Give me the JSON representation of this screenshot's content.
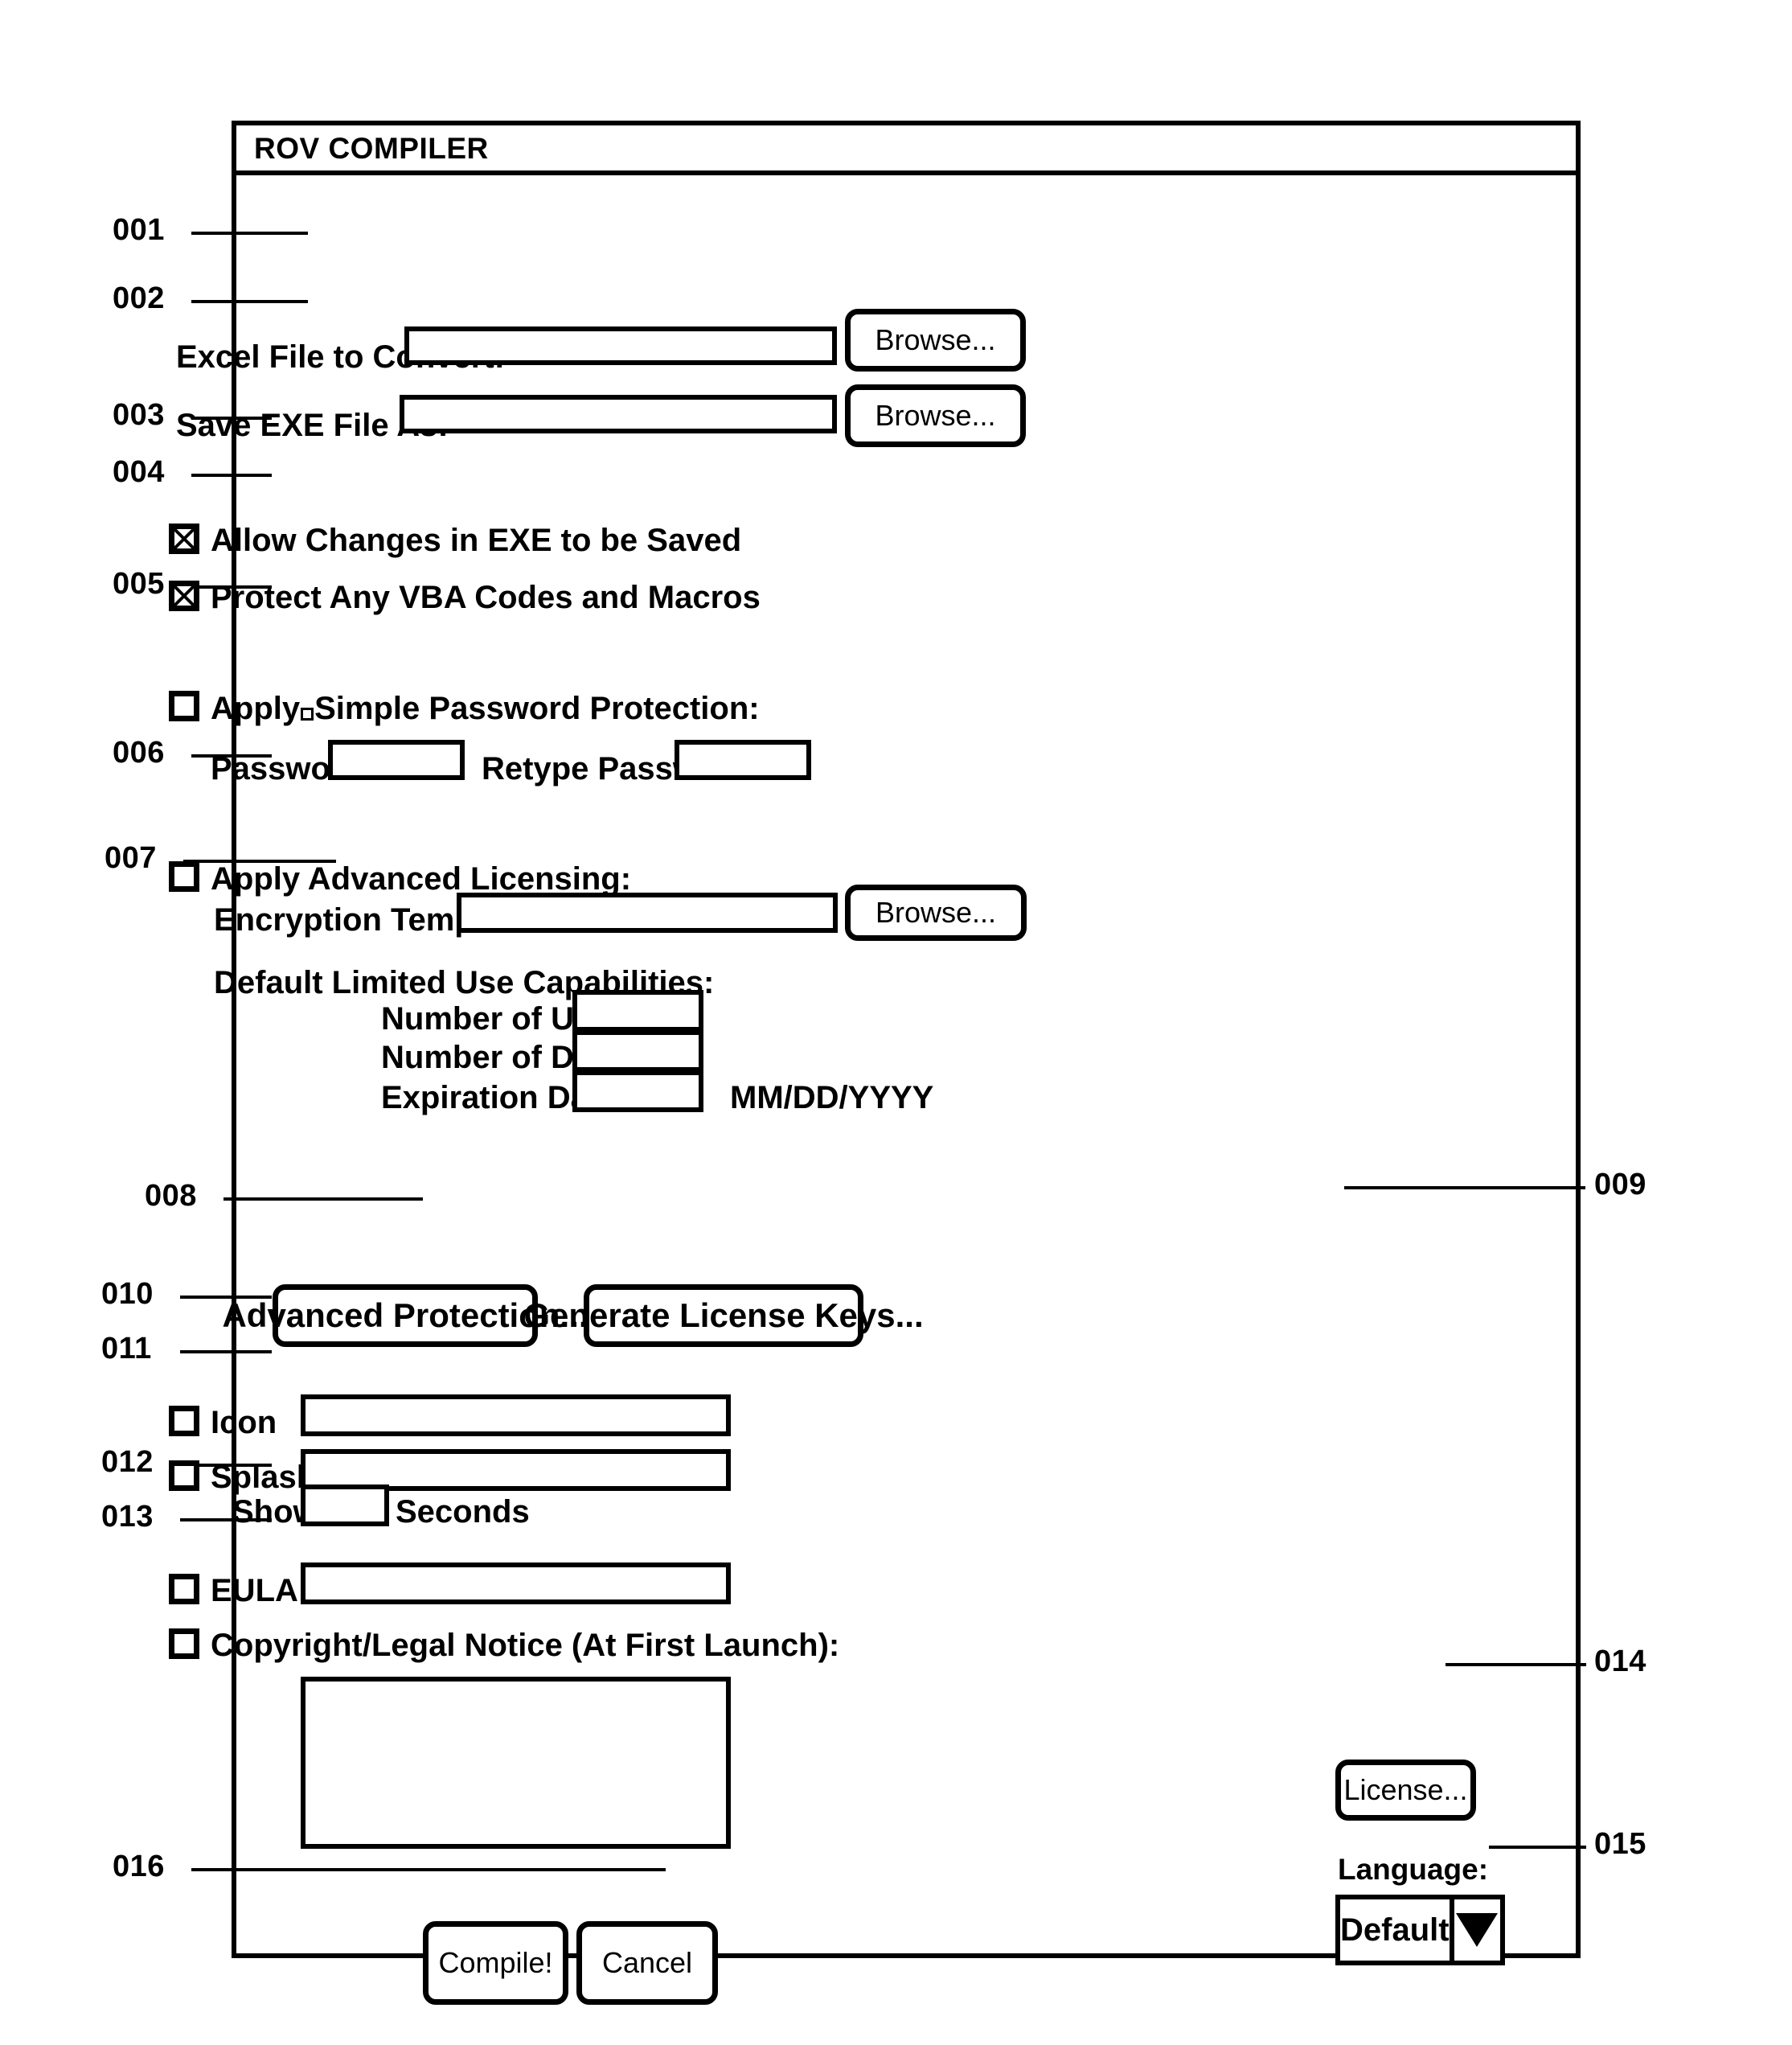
{
  "dialog": {
    "title": "ROV COMPILER"
  },
  "fields": {
    "excel_file_label": "Excel File to Convert:",
    "excel_file_value": "",
    "save_exe_label": "Save EXE File As:",
    "save_exe_value": "",
    "browse_label": "Browse...",
    "allow_changes_label": "Allow Changes in EXE to be Saved",
    "allow_changes_checked": "X",
    "protect_vba_label": "Protect Any VBA Codes and Macros",
    "protect_vba_checked": "X",
    "apply_simple_password_label_a": "Apply",
    "apply_simple_password_label_b": "Simple Password Protection:",
    "password_label": "Password:",
    "password_value": "",
    "retype_password_label": "Retype Password:",
    "retype_password_value": "",
    "apply_advanced_licensing_label": "Apply Advanced Licensing:",
    "encryption_template_label": "Encryption Template:",
    "encryption_template_value": "",
    "default_limited_use_label": "Default Limited Use Capabilities:",
    "number_of_uses_label": "Number of Uses:",
    "number_of_uses_value": "",
    "number_of_days_label": "Number of Days:",
    "number_of_days_value": "",
    "expiration_date_label": "Expiration Date:",
    "expiration_date_value": "",
    "expiration_date_format": "MM/DD/YYYY",
    "advanced_protection_label": "Advanced Protection...",
    "generate_license_keys_label": "Generate License Keys...",
    "icon_label": "Icon",
    "icon_value": "",
    "splash_label": "Splash",
    "splash_value": "",
    "show_label": "Show",
    "show_seconds_value": "",
    "seconds_label": "Seconds",
    "eula_label": "EULA",
    "eula_value": "",
    "copyright_notice_label": "Copyright/Legal Notice (At First Launch):",
    "copyright_notice_value": "",
    "license_label": "License...",
    "language_label": "Language:",
    "language_value": "Default",
    "compile_label": "Compile!",
    "cancel_label": "Cancel"
  },
  "refs": {
    "r001": "001",
    "r002": "002",
    "r003": "003",
    "r004": "004",
    "r005": "005",
    "r006": "006",
    "r007": "007",
    "r008": "008",
    "r009": "009",
    "r010": "010",
    "r011": "011",
    "r012": "012",
    "r013": "013",
    "r014": "014",
    "r015": "015",
    "r016": "016"
  }
}
